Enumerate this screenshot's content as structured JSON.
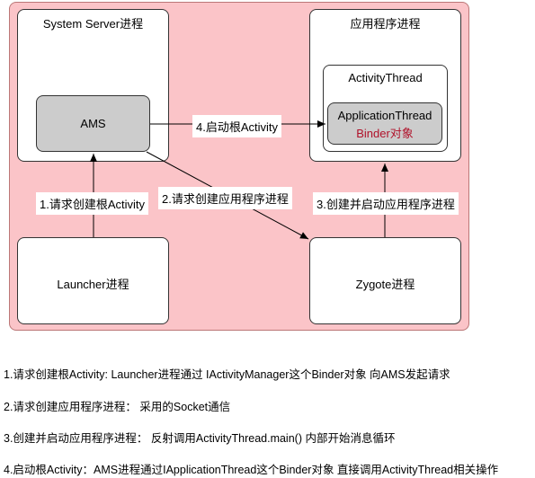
{
  "diagram": {
    "system_server": "System Server进程",
    "app_process": "应用程序进程",
    "ams": "AMS",
    "activity_thread": "ActivityThread",
    "application_thread": "ApplicationThread",
    "binder_object": "Binder对象",
    "launcher": "Launcher进程",
    "zygote": "Zygote进程",
    "edge_start_root_activity": "4.启动根Activity",
    "edge_request_root_activity": "1.请求创建根Activity",
    "edge_request_app_process": "2.请求创建应用程序进程",
    "edge_create_start_app_process": "3.创建并启动应用程序进程"
  },
  "notes": [
    "1.请求创建根Activity: Launcher进程通过 IActivityManager这个Binder对象 向AMS发起请求",
    "2.请求创建应用程序进程： 采用的Socket通信",
    "3.创建并启动应用程序进程： 反射调用ActivityThread.main() 内部开始消息循环",
    "4.启动根Activity：AMS进程通过IApplicationThread这个Binder对象 直接调用ActivityThread相关操作"
  ],
  "colors": {
    "outer_fill": "#fbc4c8",
    "node_fill": "#ffffff",
    "inner_fill": "#cccccc",
    "binder_text": "#b0122a",
    "line": "#000000"
  }
}
